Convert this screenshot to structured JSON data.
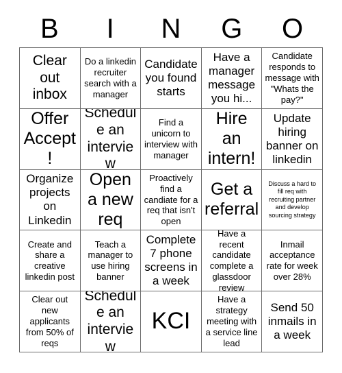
{
  "card": {
    "title": "BINGO",
    "header_letters": [
      "B",
      "I",
      "N",
      "G",
      "O"
    ],
    "columns": 5,
    "rows": 5,
    "colors": {
      "background": "#ffffff",
      "text": "#000000",
      "grid_line": "#6b6b6b"
    },
    "cells": [
      {
        "text": "Clear out inbox",
        "size": "sz-lg"
      },
      {
        "text": "Do a linkedin recruiter search with a manager",
        "size": "sz-sm"
      },
      {
        "text": "Candidate you found starts",
        "size": "sz-md"
      },
      {
        "text": "Have a manager message you hi...",
        "size": "sz-md"
      },
      {
        "text": "Candidate responds to message with \"Whats the pay?\"",
        "size": "sz-sm"
      },
      {
        "text": "Offer Accept!",
        "size": "sz-xl"
      },
      {
        "text": "Schedule an interview",
        "size": "sz-lg"
      },
      {
        "text": "Find a unicorn to interview with manager",
        "size": "sz-sm"
      },
      {
        "text": "Hire an intern!",
        "size": "sz-xl"
      },
      {
        "text": "Update hiring banner on linkedin",
        "size": "sz-md"
      },
      {
        "text": "Organize projects on Linkedin",
        "size": "sz-md"
      },
      {
        "text": "Open a new req",
        "size": "sz-xl"
      },
      {
        "text": "Proactively find a candiate for a req that isn't open",
        "size": "sz-sm"
      },
      {
        "text": "Get a referral",
        "size": "sz-xl"
      },
      {
        "text": "Discuss a hard to fill req with recruiting partner and develop sourcing strategy",
        "size": "sz-xxs"
      },
      {
        "text": "Create and share a creative linkedin post",
        "size": "sz-sm"
      },
      {
        "text": "Teach a manager to use hiring banner",
        "size": "sz-sm"
      },
      {
        "text": "Complete 7 phone screens in a week",
        "size": "sz-md"
      },
      {
        "text": "Have a recent candidate complete a glassdoor review",
        "size": "sz-sm"
      },
      {
        "text": "Inmail acceptance rate for week over 28%",
        "size": "sz-sm"
      },
      {
        "text": "Clear out new applicants from 50% of reqs",
        "size": "sz-sm"
      },
      {
        "text": "Schedule an interview",
        "size": "sz-lg"
      },
      {
        "text": "KCI",
        "size": "sz-kci"
      },
      {
        "text": "Have a strategy meeting with a service line lead",
        "size": "sz-sm"
      },
      {
        "text": "Send 50 inmails in a week",
        "size": "sz-md"
      }
    ]
  }
}
